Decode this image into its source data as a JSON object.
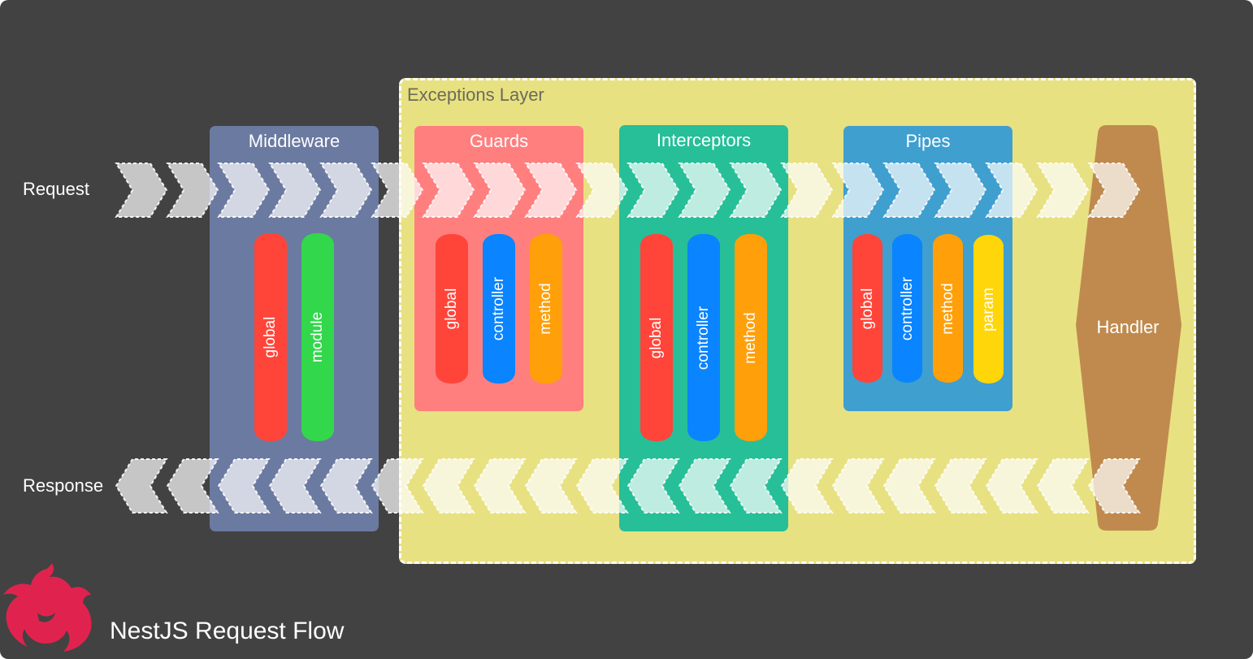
{
  "canvas": {
    "background": "#424242"
  },
  "flow_labels": {
    "request": "Request",
    "response": "Response"
  },
  "exceptions_layer": {
    "title": "Exceptions Layer",
    "color": "#e8e182"
  },
  "stages": {
    "middleware": {
      "title": "Middleware",
      "color": "#6b7aa1",
      "scopes": [
        {
          "label": "global",
          "color": "#ff453a"
        },
        {
          "label": "module",
          "color": "#32d74b"
        }
      ]
    },
    "guards": {
      "title": "Guards",
      "color": "#ff7f7f",
      "scopes": [
        {
          "label": "global",
          "color": "#ff453a"
        },
        {
          "label": "controller",
          "color": "#0a84ff"
        },
        {
          "label": "method",
          "color": "#ff9f0a"
        }
      ]
    },
    "interceptors": {
      "title": "Interceptors",
      "color": "#26bf98",
      "scopes": [
        {
          "label": "global",
          "color": "#ff453a"
        },
        {
          "label": "controller",
          "color": "#0a84ff"
        },
        {
          "label": "method",
          "color": "#ff9f0a"
        }
      ]
    },
    "pipes": {
      "title": "Pipes",
      "color": "#3f9fcf",
      "scopes": [
        {
          "label": "global",
          "color": "#ff453a"
        },
        {
          "label": "controller",
          "color": "#0a84ff"
        },
        {
          "label": "method",
          "color": "#ff9f0a"
        },
        {
          "label": "param",
          "color": "#ffd60a"
        }
      ]
    },
    "handler": {
      "title": "Handler",
      "color": "#c08a4e"
    }
  },
  "footer": {
    "title": "NestJS Request Flow",
    "logo_color": "#e0234e",
    "logo_icon": "nestjs-logo"
  }
}
